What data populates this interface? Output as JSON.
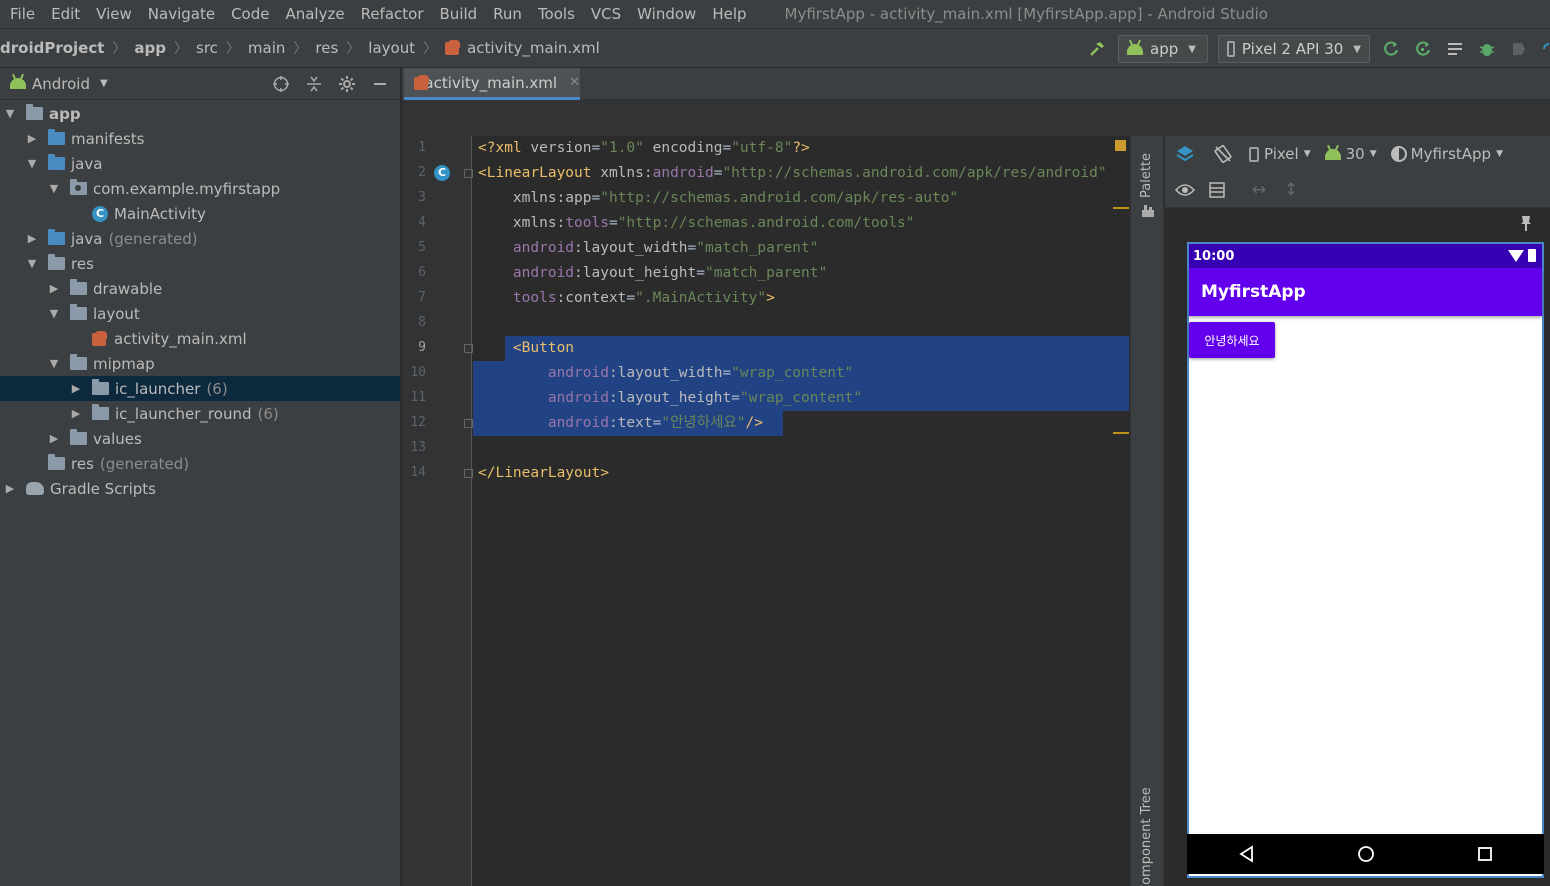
{
  "menu": [
    "File",
    "Edit",
    "View",
    "Navigate",
    "Code",
    "Analyze",
    "Refactor",
    "Build",
    "Run",
    "Tools",
    "VCS",
    "Window",
    "Help"
  ],
  "window_title": "MyfirstApp - activity_main.xml [MyfirstApp.app] - Android Studio",
  "breadcrumb": [
    "droidProject",
    "app",
    "src",
    "main",
    "res",
    "layout",
    "activity_main.xml"
  ],
  "run_toolbar": {
    "config": "app",
    "device": "Pixel 2 API 30",
    "icons": [
      "hammer-icon",
      "apply-changes-icon",
      "apply-code-changes-icon",
      "coverage-icon",
      "debug-icon",
      "profile-icon"
    ]
  },
  "project_panel": {
    "view_mode": "Android",
    "tree": [
      {
        "label": "app",
        "extra": "",
        "icon": "folder",
        "expanded": true,
        "level": 0,
        "bold": true
      },
      {
        "label": "manifests",
        "extra": "",
        "icon": "folder-blue",
        "expanded": false,
        "level": 1
      },
      {
        "label": "java",
        "extra": "",
        "icon": "folder-blue",
        "expanded": true,
        "level": 1
      },
      {
        "label": "com.example.myfirstapp",
        "extra": "",
        "icon": "package",
        "expanded": true,
        "level": 2
      },
      {
        "label": "MainActivity",
        "extra": "",
        "icon": "class",
        "level": 3
      },
      {
        "label": "java",
        "extra": "(generated)",
        "icon": "folder-gen",
        "expanded": false,
        "level": 1
      },
      {
        "label": "res",
        "extra": "",
        "icon": "folder",
        "expanded": true,
        "level": 1
      },
      {
        "label": "drawable",
        "extra": "",
        "icon": "folder",
        "expanded": false,
        "level": 2
      },
      {
        "label": "layout",
        "extra": "",
        "icon": "folder",
        "expanded": true,
        "level": 2
      },
      {
        "label": "activity_main.xml",
        "extra": "",
        "icon": "xml",
        "level": 3
      },
      {
        "label": "mipmap",
        "extra": "",
        "icon": "folder",
        "expanded": true,
        "level": 2
      },
      {
        "label": "ic_launcher",
        "extra": "(6)",
        "icon": "folder",
        "expanded": false,
        "level": 3,
        "selected": true
      },
      {
        "label": "ic_launcher_round",
        "extra": "(6)",
        "icon": "folder",
        "expanded": false,
        "level": 3
      },
      {
        "label": "values",
        "extra": "",
        "icon": "folder",
        "expanded": false,
        "level": 2
      },
      {
        "label": "res",
        "extra": "(generated)",
        "icon": "folder",
        "level": 1
      },
      {
        "label": "Gradle Scripts",
        "extra": "",
        "icon": "gradle",
        "expanded": false,
        "level": 0
      }
    ]
  },
  "editor": {
    "tab_label": "activity_main.xml",
    "line_numbers": [
      "1",
      "2",
      "3",
      "4",
      "5",
      "6",
      "7",
      "8",
      "9",
      "10",
      "11",
      "12",
      "13",
      "14"
    ],
    "current_line": "9",
    "selected_lines": [
      "9",
      "10",
      "11",
      "12"
    ],
    "lines": [
      [
        [
          "t-pi",
          "<?xml "
        ],
        [
          "t-attr",
          "version"
        ],
        [
          "t-txt",
          "="
        ],
        [
          "t-str",
          "\"1.0\""
        ],
        [
          "t-attr",
          " encoding"
        ],
        [
          "t-txt",
          "="
        ],
        [
          "t-str",
          "\"utf-8\""
        ],
        [
          "t-pi",
          "?>"
        ]
      ],
      [
        [
          "t-tag",
          "<LinearLayout "
        ],
        [
          "t-attr",
          "xmlns:"
        ],
        [
          "t-ns",
          "android"
        ],
        [
          "t-txt",
          "="
        ],
        [
          "t-str",
          "\"http://schemas.android.com/apk/res/android\""
        ]
      ],
      [
        [
          "t-attr",
          "    xmlns:app"
        ],
        [
          "t-txt",
          "="
        ],
        [
          "t-str",
          "\"http://schemas.android.com/apk/res-auto\""
        ]
      ],
      [
        [
          "t-attr",
          "    xmlns:"
        ],
        [
          "t-ns",
          "tools"
        ],
        [
          "t-txt",
          "="
        ],
        [
          "t-str",
          "\"http://schemas.android.com/tools\""
        ]
      ],
      [
        [
          "t-ns",
          "    android"
        ],
        [
          "t-attr",
          ":layout_width"
        ],
        [
          "t-txt",
          "="
        ],
        [
          "t-str",
          "\"match_parent\""
        ]
      ],
      [
        [
          "t-ns",
          "    android"
        ],
        [
          "t-attr",
          ":layout_height"
        ],
        [
          "t-txt",
          "="
        ],
        [
          "t-str",
          "\"match_parent\""
        ]
      ],
      [
        [
          "t-ns",
          "    tools"
        ],
        [
          "t-attr",
          ":context"
        ],
        [
          "t-txt",
          "="
        ],
        [
          "t-str",
          "\".MainActivity\""
        ],
        [
          "t-tag",
          ">"
        ]
      ],
      [],
      [
        [
          "t-tag",
          "    <Button"
        ]
      ],
      [
        [
          "t-ns",
          "        android"
        ],
        [
          "t-attr",
          ":layout_width"
        ],
        [
          "t-txt",
          "="
        ],
        [
          "t-str",
          "\"wrap_content\""
        ]
      ],
      [
        [
          "t-ns",
          "        android"
        ],
        [
          "t-attr",
          ":layout_height"
        ],
        [
          "t-txt",
          "="
        ],
        [
          "t-str",
          "\"wrap_content\""
        ]
      ],
      [
        [
          "t-ns",
          "        android"
        ],
        [
          "t-attr",
          ":text"
        ],
        [
          "t-txt",
          "="
        ],
        [
          "t-str",
          "\"안녕하세요\""
        ],
        [
          "t-tag",
          "/>"
        ]
      ],
      [],
      [
        [
          "t-tag",
          "</LinearLayout>"
        ]
      ]
    ]
  },
  "side_tabs": {
    "palette": "Palette",
    "component_tree": "Component Tree"
  },
  "design_toolbar": {
    "device": "Pixel",
    "api": "30",
    "theme": "MyfirstApp"
  },
  "preview": {
    "time": "10:00",
    "app_title": "MyfirstApp",
    "button_text": "안녕하세요"
  },
  "colors": {
    "status_bar": "#3700b3",
    "app_bar": "#6200ee",
    "selection": "#214283",
    "tree_selection": "#0d293e"
  }
}
